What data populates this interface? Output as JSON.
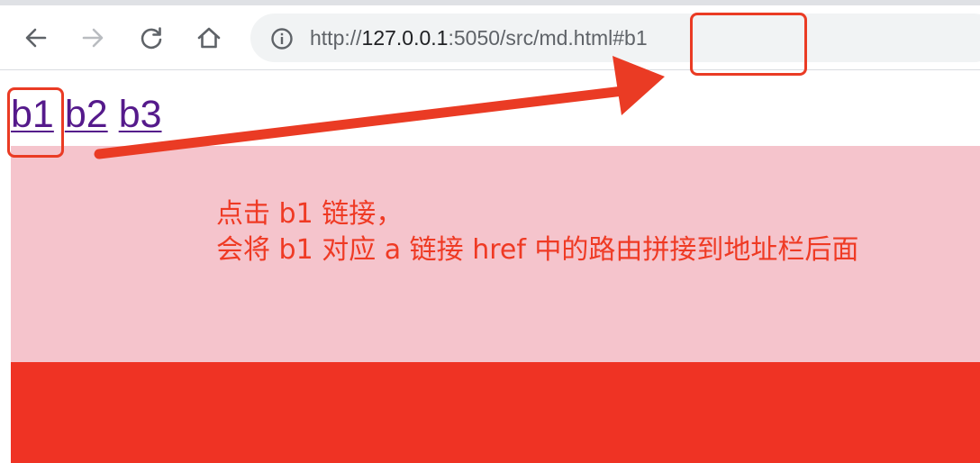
{
  "browser": {
    "address_bar": {
      "scheme": "http://",
      "host": "127.0.0.1",
      "path": ":5050/src/md.html#b1"
    },
    "icons": {
      "back": "arrow-left-icon",
      "forward": "arrow-right-icon",
      "reload": "reload-icon",
      "home": "home-icon",
      "site_info": "info-icon"
    }
  },
  "page": {
    "links": [
      {
        "label": "b1"
      },
      {
        "label": "b2"
      },
      {
        "label": "b3"
      }
    ],
    "colors": {
      "link": "#551a8b",
      "pink_section": "#f5c4cc",
      "red_section": "#ef3324"
    }
  },
  "annotation": {
    "line1": "点击 b1 链接，",
    "line2": "会将 b1 对应 a 链接 href 中的路由拼接到地址栏后面",
    "color": "#ef3a24"
  }
}
